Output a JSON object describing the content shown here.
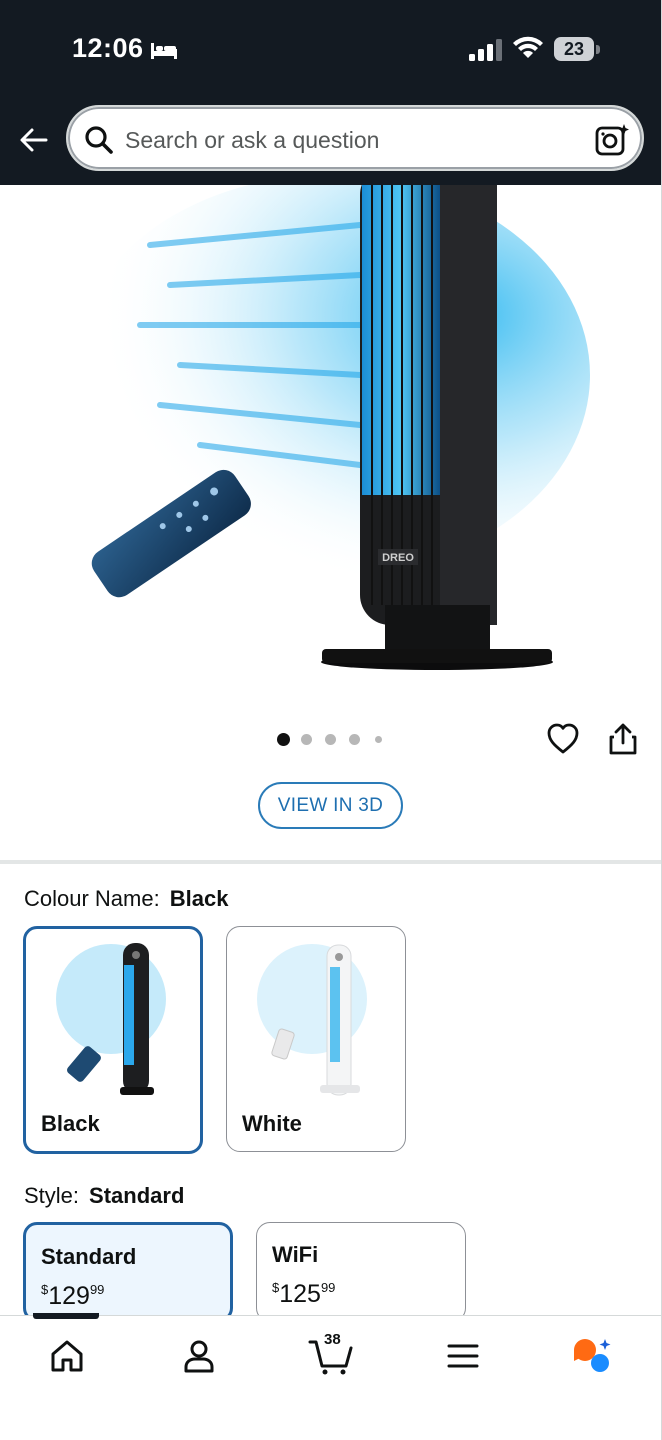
{
  "status_bar": {
    "time": "12:06",
    "battery": "23",
    "icons": [
      "bed-icon",
      "signal-icon",
      "wifi-icon",
      "battery-icon"
    ]
  },
  "header": {
    "back_icon": "arrow-left-icon",
    "search_placeholder": "Search or ask a question",
    "search_icon": "search-icon",
    "lens_icon": "camera-lens-icon"
  },
  "gallery": {
    "image_count": 5,
    "active_index": 0,
    "brand_mark": "DREO",
    "actions": [
      "heart-icon",
      "share-icon"
    ],
    "view_3d_label": "VIEW IN 3D"
  },
  "colour": {
    "label": "Colour Name:",
    "selected": "Black",
    "options": [
      {
        "name": "Black",
        "selected": true
      },
      {
        "name": "White",
        "selected": false
      }
    ]
  },
  "style": {
    "label": "Style:",
    "selected": "Standard",
    "options": [
      {
        "name": "Standard",
        "currency": "$",
        "price_whole": "129",
        "price_fraction": "99",
        "selected": true
      },
      {
        "name": "WiFi",
        "currency": "$",
        "price_whole": "125",
        "price_fraction": "99",
        "selected": false
      }
    ]
  },
  "bottom_nav": {
    "items": [
      "home-icon",
      "account-icon",
      "cart-icon",
      "menu-icon",
      "rufus-assistant-icon"
    ],
    "cart_count": "38",
    "active": "home-icon"
  },
  "colors": {
    "header_bg": "#131a22",
    "accent_blue": "#2162a1",
    "link_blue": "#1e6fb0",
    "assistant_orange": "#ff6a13",
    "assistant_blue": "#1a8cff"
  }
}
